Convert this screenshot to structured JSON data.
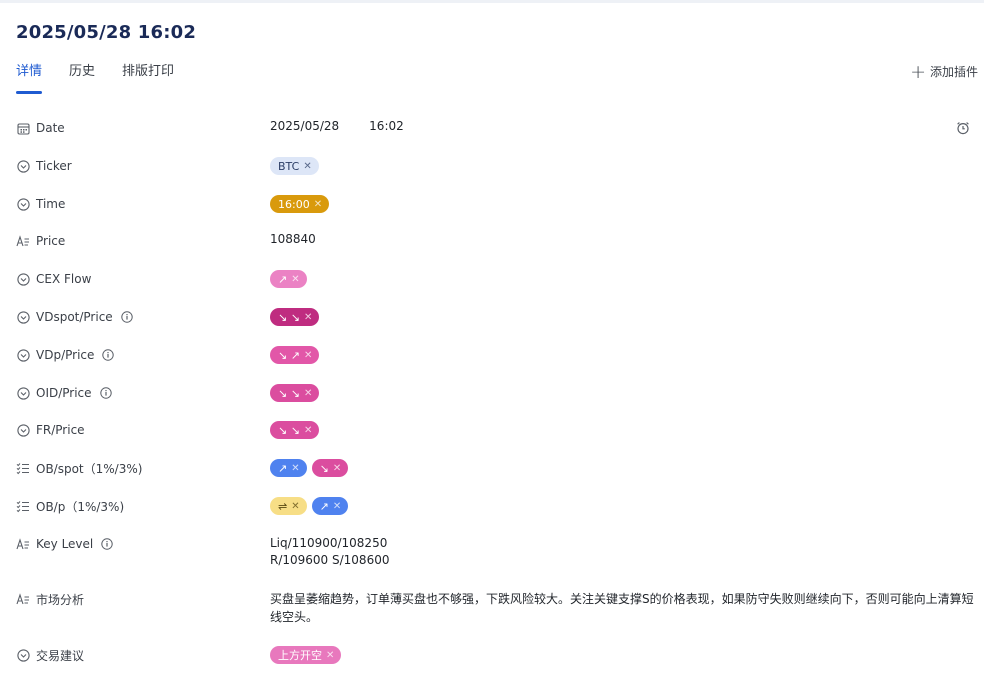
{
  "header": {
    "title": "2025/05/28 16:02"
  },
  "tabs": [
    {
      "label": "详情"
    },
    {
      "label": "历史"
    },
    {
      "label": "排版打印"
    }
  ],
  "add_plugin": {
    "label": "添加插件"
  },
  "fields": {
    "date": {
      "label": "Date",
      "date": "2025/05/28",
      "time": "16:02"
    },
    "ticker": {
      "label": "Ticker",
      "tags": [
        {
          "text": "BTC",
          "bg": "#dde6f7",
          "fg": "#2c3e66"
        }
      ]
    },
    "time": {
      "label": "Time",
      "tags": [
        {
          "text": "16:00",
          "bg": "#d99a0c",
          "fg": "#ffffff"
        }
      ]
    },
    "price": {
      "label": "Price",
      "value": "108840"
    },
    "cex_flow": {
      "label": "CEX Flow",
      "tags": [
        {
          "text": "↗",
          "bg": "#eb82c4",
          "fg": "#ffffff"
        }
      ]
    },
    "vdspot_price": {
      "label": "VDspot/Price",
      "tags": [
        {
          "text": "↘ ↘",
          "bg": "#bf2c80",
          "fg": "#ffffff"
        }
      ]
    },
    "vdp_price": {
      "label": "VDp/Price",
      "tags": [
        {
          "text": "↘ ↗",
          "bg": "#e257a8",
          "fg": "#ffffff"
        }
      ]
    },
    "oid_price": {
      "label": "OID/Price",
      "tags": [
        {
          "text": "↘ ↘",
          "bg": "#db4d9f",
          "fg": "#ffffff"
        }
      ]
    },
    "fr_price": {
      "label": "FR/Price",
      "tags": [
        {
          "text": "↘ ↘",
          "bg": "#db4d9f",
          "fg": "#ffffff"
        }
      ]
    },
    "ob_spot": {
      "label": "OB/spot（1%/3%)",
      "tags": [
        {
          "text": "↗",
          "bg": "#4f82ef",
          "fg": "#ffffff"
        },
        {
          "text": "↘",
          "bg": "#db4d9f",
          "fg": "#ffffff"
        }
      ]
    },
    "ob_p": {
      "label": "OB/p（1%/3%)",
      "tags": [
        {
          "text": "⇌",
          "bg": "#f7de86",
          "fg": "#5a4a12"
        },
        {
          "text": "↗",
          "bg": "#4f82ef",
          "fg": "#ffffff"
        }
      ]
    },
    "key_level": {
      "label": "Key Level",
      "line1": "Liq/110900/108250",
      "line2": "R/109600 S/108600"
    },
    "market_analysis": {
      "label": "市场分析",
      "value": "买盘呈萎缩趋势，订单薄买盘也不够强，下跌风险较大。关注关键支撑S的价格表现，如果防守失败则继续向下，否则可能向上清算短线空头。"
    },
    "trade_advice": {
      "label": "交易建议",
      "tags": [
        {
          "text": "上方开空",
          "bg": "#e878bd",
          "fg": "#ffffff"
        }
      ]
    }
  },
  "colors": {
    "accent": "#1f5bd1",
    "title": "#1a2a57"
  }
}
